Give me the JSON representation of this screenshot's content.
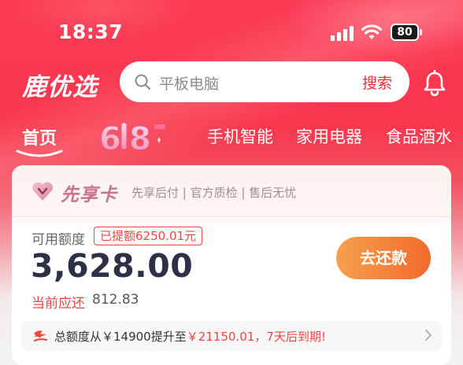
{
  "status_bar": {
    "time": "18:37",
    "battery": "80"
  },
  "header": {
    "logo": "鹿优选",
    "search": {
      "placeholder": "平板电脑",
      "button": "搜索"
    }
  },
  "tabs": {
    "items": [
      {
        "label": "首页",
        "active": true
      },
      {
        "label": "6|8",
        "type": "promo-badge"
      },
      {
        "label": "手机智能"
      },
      {
        "label": "家用电器"
      },
      {
        "label": "食品酒水"
      }
    ]
  },
  "card": {
    "title": "先享卡",
    "subtitle": "先享后付 | 官方质检 | 售后无忧",
    "available_label": "可用额度",
    "withdrawn_badge": "已提额6250.01元",
    "amount": "3,628.00",
    "due_label": "当前应还",
    "due_value": "812.83",
    "repay_button": "去还款",
    "notice": {
      "prefix": "总额度从￥14900提升至",
      "highlight": "￥21150.01，7天后到期!"
    }
  },
  "colors": {
    "brand_red": "#f8364c",
    "accent_red": "#f0453e",
    "orange_gradient_start": "#f7a04f",
    "orange_gradient_end": "#f26a2c",
    "amount_text": "#2d3047"
  },
  "icons": [
    "cellular-signal-icon",
    "wifi-icon",
    "battery-icon",
    "search-icon",
    "bell-icon",
    "heart-vip-icon",
    "promo-flame-icon",
    "chevron-right-icon"
  ]
}
